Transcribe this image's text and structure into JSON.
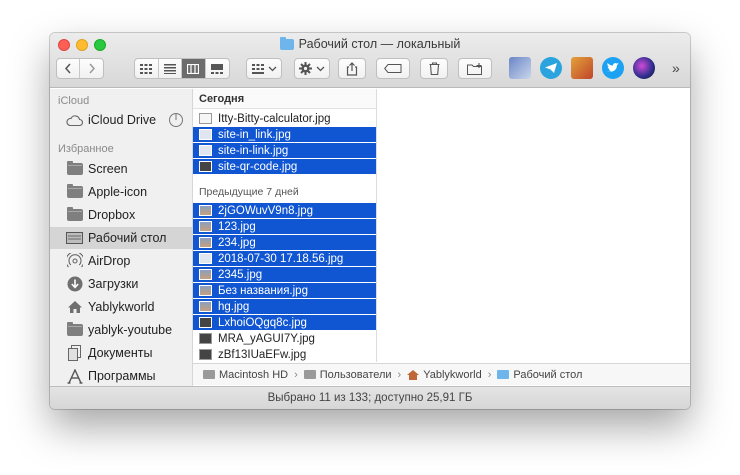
{
  "window": {
    "title": "Рабочий стол — локальный"
  },
  "toolbar": {
    "more": "»"
  },
  "sidebar": {
    "icloud_header": "iCloud",
    "icloud_drive": "iCloud Drive",
    "favorites_header": "Избранное",
    "items": [
      {
        "label": "Screen",
        "icon": "folder-icon"
      },
      {
        "label": "Apple-icon",
        "icon": "folder-icon"
      },
      {
        "label": "Dropbox",
        "icon": "folder-icon"
      },
      {
        "label": "Рабочий стол",
        "icon": "desktop-icon"
      },
      {
        "label": "AirDrop",
        "icon": "airdrop-icon"
      },
      {
        "label": "Загрузки",
        "icon": "downloads-icon"
      },
      {
        "label": "Yablykworld",
        "icon": "home-icon"
      },
      {
        "label": "yablyk-youtube",
        "icon": "folder-icon"
      },
      {
        "label": "Документы",
        "icon": "documents-icon"
      },
      {
        "label": "Программы",
        "icon": "applications-icon"
      }
    ]
  },
  "column": {
    "header": "Сегодня",
    "today_files": [
      {
        "name": "Itty-Bitty-calculator.jpg",
        "selected": false
      },
      {
        "name": "site-in_link.jpg",
        "selected": true
      },
      {
        "name": "site-in-link.jpg",
        "selected": true
      },
      {
        "name": "site-qr-code.jpg",
        "selected": true
      }
    ],
    "previous_label": "Предыдущие 7 дней",
    "previous_files": [
      {
        "name": "2jGOWuvV9n8.jpg",
        "selected": true
      },
      {
        "name": "123.jpg",
        "selected": true
      },
      {
        "name": "234.jpg",
        "selected": true
      },
      {
        "name": "2018-07-30 17.18.56.jpg",
        "selected": true
      },
      {
        "name": "2345.jpg",
        "selected": true
      },
      {
        "name": "Без названия.jpg",
        "selected": true
      },
      {
        "name": "hg.jpg",
        "selected": true
      },
      {
        "name": "LxhoiOQgq8c.jpg",
        "selected": true
      },
      {
        "name": "MRA_yAGUI7Y.jpg",
        "selected": false
      },
      {
        "name": "zBf13IUaEFw.jpg",
        "selected": false
      }
    ]
  },
  "pathbar": {
    "items": [
      "Macintosh HD",
      "Пользователи",
      "Yablykworld",
      "Рабочий стол"
    ],
    "separator": "›"
  },
  "status": {
    "text": "Выбрано 11 из 133; доступно 25,91 ГБ"
  },
  "colors": {
    "selection": "#1056d3",
    "close": "#fd5f57",
    "minimize": "#febc2e",
    "zoom": "#28c840"
  }
}
